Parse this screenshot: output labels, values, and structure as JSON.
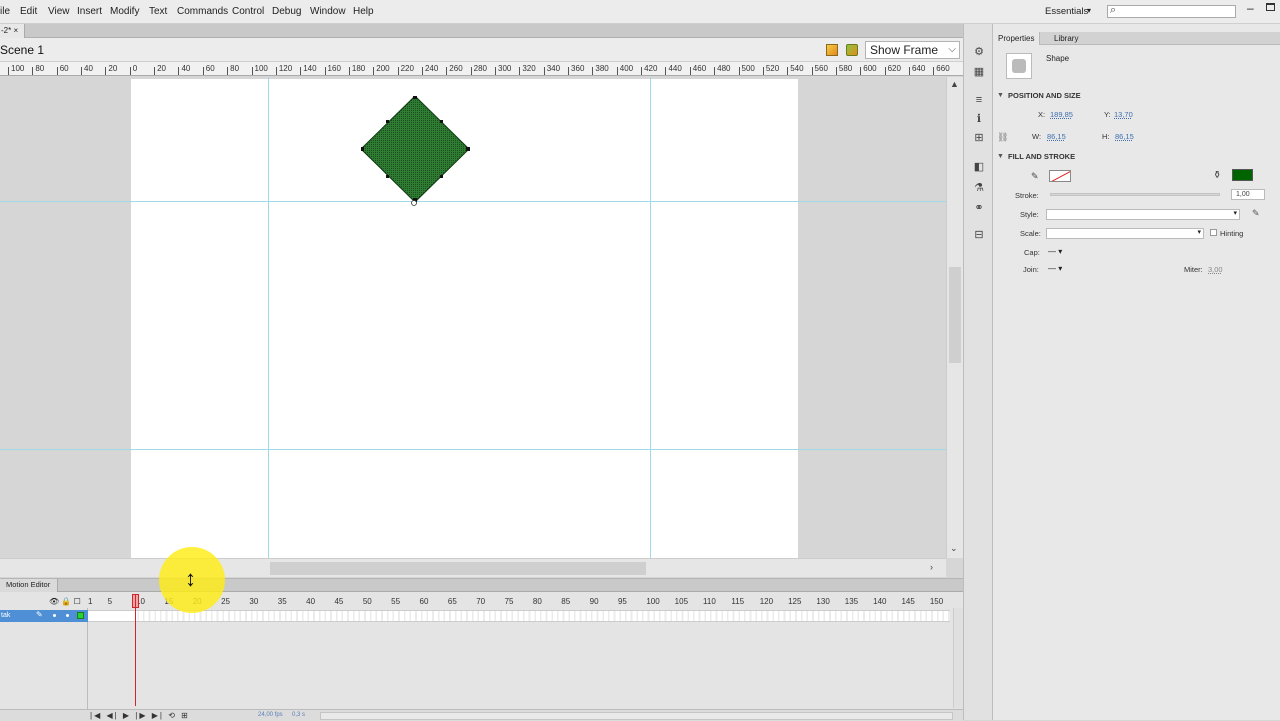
{
  "menubar": {
    "items": [
      "ile",
      "Edit",
      "View",
      "Insert",
      "Modify",
      "Text",
      "Commands",
      "Control",
      "Debug",
      "Window",
      "Help"
    ],
    "workspace": "Essentials"
  },
  "document": {
    "tab": "-2*",
    "close": "×",
    "scene": "Scene 1",
    "zoom": "Show Frame"
  },
  "ruler": {
    "labels": [
      "100",
      "80",
      "60",
      "40",
      "20",
      "0",
      "20",
      "40",
      "60",
      "80",
      "100",
      "120",
      "140",
      "160",
      "180",
      "200",
      "220",
      "240",
      "260",
      "280",
      "300",
      "320",
      "340",
      "360",
      "380",
      "400",
      "420",
      "440",
      "460",
      "480",
      "500",
      "520",
      "540",
      "560",
      "580",
      "600",
      "620",
      "640",
      "660"
    ]
  },
  "colors": {
    "shape_fill": "#2e7d32",
    "guide": "#9fdbe6",
    "fill_swatch": "#006400",
    "layer_selected": "#4e8fd6",
    "playhead": "#d0252a",
    "cursor_highlight": "#ffec14"
  },
  "timeline": {
    "tab": "Motion Editor",
    "frame_numbers": [
      "1",
      "5",
      "10",
      "15",
      "20",
      "25",
      "30",
      "35",
      "40",
      "45",
      "50",
      "55",
      "60",
      "65",
      "70",
      "75",
      "80",
      "85",
      "90",
      "95",
      "100",
      "105",
      "110",
      "115",
      "120",
      "125",
      "130",
      "135",
      "140",
      "145",
      "150"
    ],
    "current_frame": 10,
    "layer_name": "tak",
    "fps": "24,00 fps",
    "elapsed": "0,3 s"
  },
  "properties": {
    "tabs": [
      "Properties",
      "Library"
    ],
    "instance": "Shape",
    "position_size": {
      "title": "POSITION AND SIZE",
      "x_label": "X:",
      "x": "189,85",
      "y_label": "Y:",
      "y": "13,70",
      "w_label": "W:",
      "w": "86,15",
      "h_label": "H:",
      "h": "86,15"
    },
    "fill_stroke": {
      "title": "FILL AND STROKE",
      "stroke_label": "Stroke:",
      "stroke_value": "1,00",
      "style_label": "Style:",
      "scale_label": "Scale:",
      "hinting_label": "Hinting",
      "cap_label": "Cap:",
      "cap_value": "— ▾",
      "join_label": "Join:",
      "join_value": "— ▾",
      "miter_label": "Miter:",
      "miter_value": "3,00"
    }
  }
}
